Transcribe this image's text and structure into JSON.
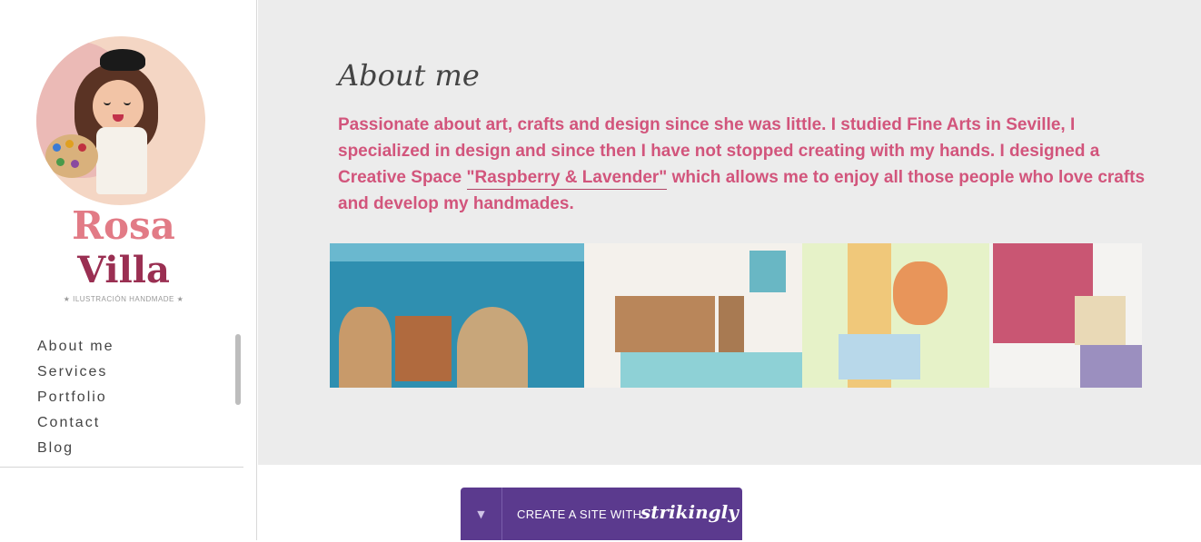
{
  "logo": {
    "name_line1": "Rosa",
    "name_line2": "Villa",
    "tagline": "★ ILUSTRACIÓN HANDMADE ★"
  },
  "nav": {
    "items": [
      {
        "label": "About me"
      },
      {
        "label": "Services"
      },
      {
        "label": "Portfolio"
      },
      {
        "label": "Contact"
      },
      {
        "label": "Blog"
      }
    ]
  },
  "about": {
    "title": "About me",
    "text_before": "Passionate about art, crafts and design since she was little. I studied Fine Arts in Seville, I specialized in design and since then I have not stopped creating with my hands. I designed a Creative Space ",
    "link_text": "\"Raspberry & Lavender\"",
    "text_after": " which allows me to enjoy all those people who love crafts and develop my handmades."
  },
  "banner": {
    "caret": "▼",
    "text": "CREATE A SITE WITH",
    "brand": "strikingly"
  },
  "colors": {
    "accent_pink": "#d2557c",
    "banner_purple": "#5b3a8e",
    "content_bg": "#ececec"
  }
}
